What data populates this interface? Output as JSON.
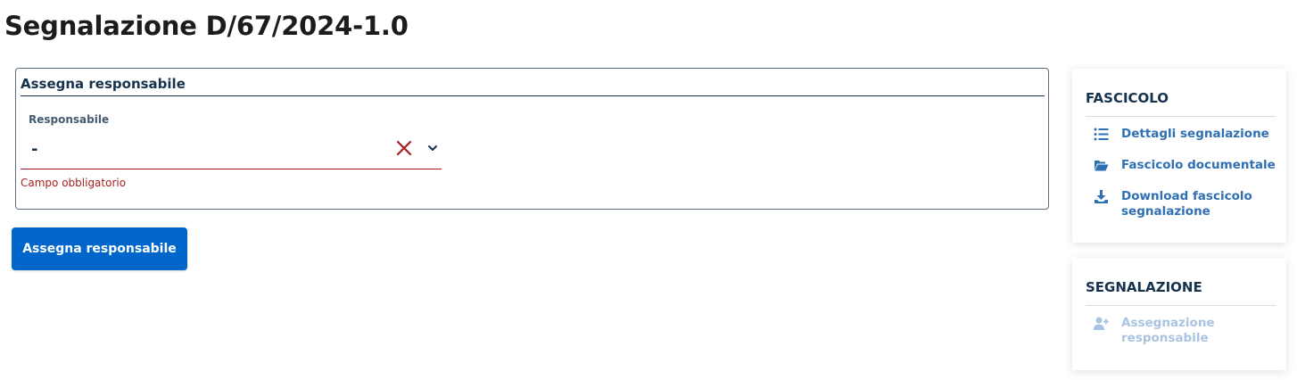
{
  "page": {
    "title": "Segnalazione D/67/2024-1.0"
  },
  "form": {
    "legend": "Assegna responsabile",
    "responsabile": {
      "label": "Responsabile",
      "value": "-",
      "error": "Campo obbligatorio"
    },
    "submit_label": "Assegna responsabile"
  },
  "sidebar": {
    "fascicolo": {
      "title": "FASCICOLO",
      "items": [
        {
          "label": "Dettagli segnalazione",
          "icon": "list-icon"
        },
        {
          "label": "Fascicolo documentale",
          "icon": "folder-open-icon"
        },
        {
          "label": "Download fascicolo segnalazione",
          "icon": "download-icon"
        }
      ]
    },
    "segnalazione": {
      "title": "SEGNALAZIONE",
      "items": [
        {
          "label": "Assegnazione responsabile",
          "icon": "user-plus-icon",
          "disabled": true
        }
      ]
    }
  },
  "colors": {
    "primary": "#0066cc",
    "link": "#2f6fb3",
    "link_disabled": "#a9c3e0",
    "error": "#a61e22",
    "heading": "#17324d"
  }
}
